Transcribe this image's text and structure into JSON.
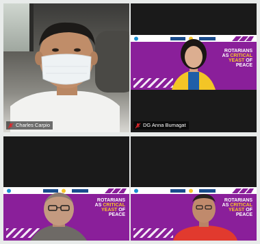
{
  "participants": [
    {
      "name": "Charles Carpio",
      "muted": true
    },
    {
      "name": "DG Anna Bumagat",
      "muted": true
    },
    {
      "name": "",
      "muted": false
    },
    {
      "name": "",
      "muted": false
    }
  ],
  "slide": {
    "line1": "ROTARIANS",
    "line2_prefix": "AS ",
    "line2_accent": "CRITICAL",
    "line3_accent": "YEAST",
    "line3_suffix": " OF",
    "line4": "PEACE"
  },
  "colors": {
    "slide_purple": "#8a1f9a",
    "accent_yellow": "#f6c42a",
    "mic_off_red": "#e0262b"
  }
}
